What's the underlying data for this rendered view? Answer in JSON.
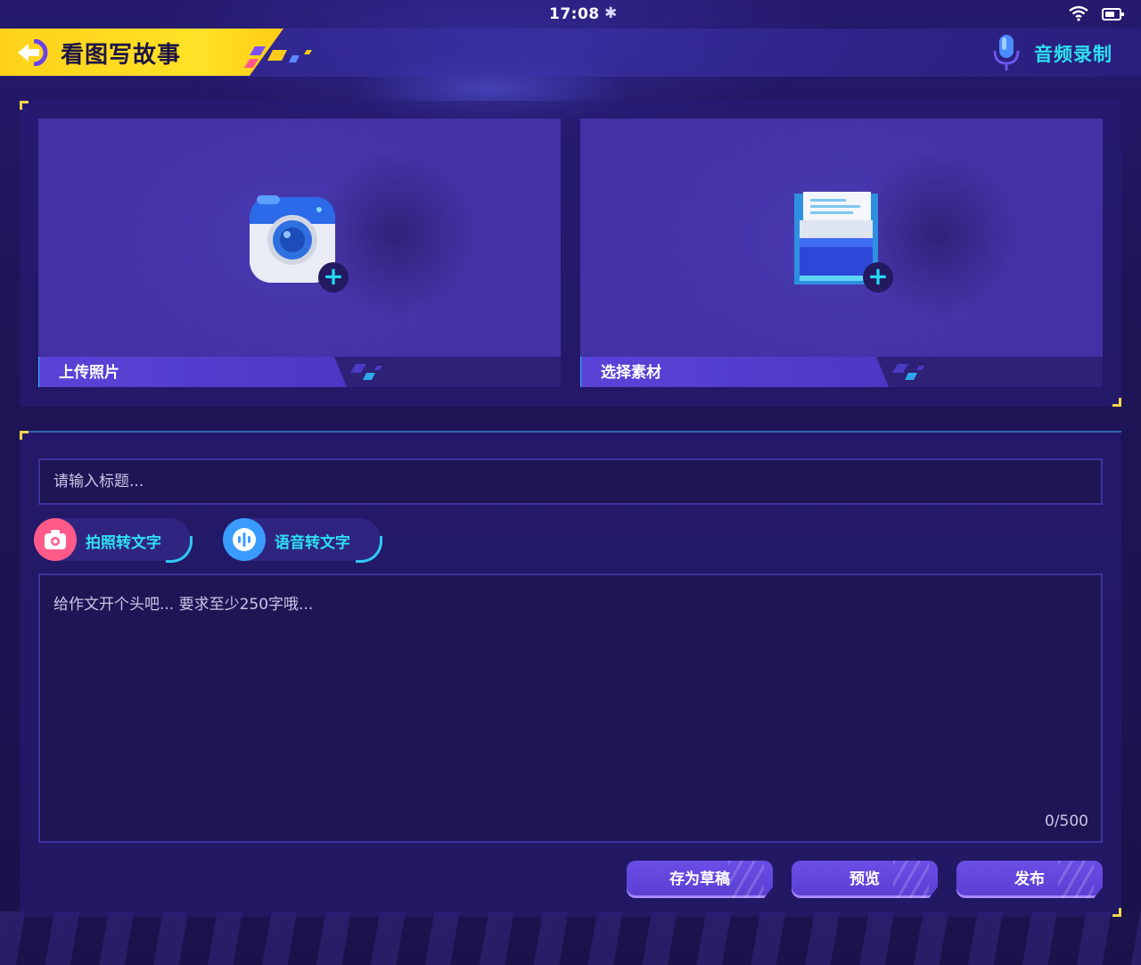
{
  "status_bar": {
    "time": "17:08"
  },
  "header": {
    "title": "看图写故事",
    "audio_label": "音频录制"
  },
  "cards": [
    {
      "label": "上传照片",
      "icon": "camera-icon"
    },
    {
      "label": "选择素材",
      "icon": "folder-icon"
    }
  ],
  "editor": {
    "title_placeholder": "请输入标题...",
    "pills": [
      {
        "label": "拍照转文字",
        "icon": "camera-icon",
        "color": "#ff5a8a"
      },
      {
        "label": "语音转文字",
        "icon": "voice-wave-icon",
        "color": "#3a9bff"
      }
    ],
    "body_placeholder": "给作文开个头吧... 要求至少250字哦...",
    "counter": "0/500"
  },
  "actions": {
    "save_draft": "存为草稿",
    "preview": "预览",
    "publish": "发布"
  },
  "colors": {
    "accent_yellow": "#ffd21a",
    "accent_cyan": "#2ee0f2",
    "panel": "#4434a8",
    "button": "#5a3fd2"
  }
}
